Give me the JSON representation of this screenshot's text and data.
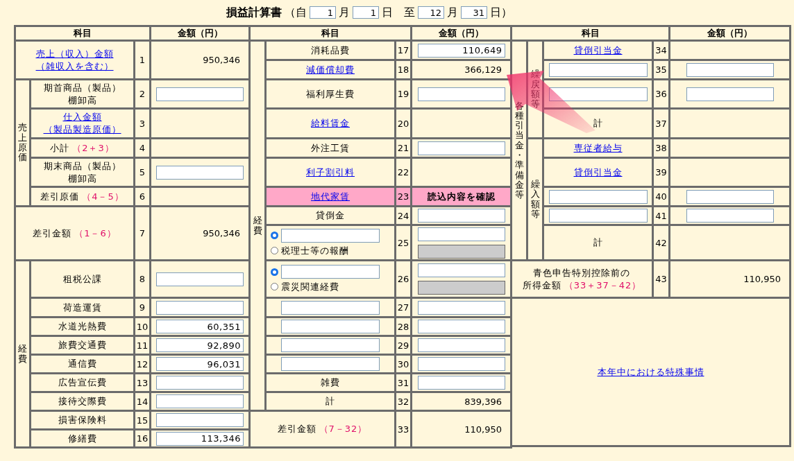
{
  "title": "損益計算書",
  "period": [
    {
      "kind": "text",
      "text": "（自"
    },
    {
      "kind": "field",
      "value": "1"
    },
    {
      "kind": "text",
      "text": "月"
    },
    {
      "kind": "field",
      "value": "1"
    },
    {
      "kind": "text",
      "text": "日　至"
    },
    {
      "kind": "field",
      "value": "12"
    },
    {
      "kind": "text",
      "text": "月"
    },
    {
      "kind": "field",
      "value": "31"
    },
    {
      "kind": "text",
      "text": "日）"
    }
  ],
  "left": {
    "headers": [
      "科目",
      "金額（円）"
    ],
    "sections": [
      {
        "kind": "single",
        "row": {
          "no": "1",
          "label": {
            "kind": "link",
            "lines": [
              "売上（収入）金額",
              "（雑収入を含む）"
            ]
          },
          "amount": {
            "kind": "text",
            "value": "950,346"
          }
        }
      },
      {
        "kind": "group",
        "label": "売上原価",
        "rows": [
          {
            "no": "2",
            "label": {
              "kind": "text",
              "lines": [
                "期首商品（製品）",
                "棚卸高"
              ]
            },
            "amount": {
              "kind": "field"
            }
          },
          {
            "no": "3",
            "label": {
              "kind": "link",
              "lines": [
                "仕入金額",
                "（製品製造原価）"
              ]
            },
            "amount": {
              "kind": "none"
            }
          },
          {
            "no": "4",
            "label": {
              "kind": "text",
              "lines": [
                "小計"
              ]
            },
            "formula": "（2＋3）",
            "amount": {
              "kind": "none"
            }
          },
          {
            "no": "5",
            "label": {
              "kind": "text",
              "lines": [
                "期末商品（製品）",
                "棚卸高"
              ]
            },
            "amount": {
              "kind": "field"
            }
          },
          {
            "no": "6",
            "label": {
              "kind": "text",
              "lines": [
                "差引原価"
              ]
            },
            "formula": "（4－5）",
            "amount": {
              "kind": "none"
            }
          }
        ]
      },
      {
        "kind": "single",
        "row": {
          "no": "7",
          "label": {
            "kind": "text",
            "lines": [
              "差引金額"
            ]
          },
          "formula": "（1－6）",
          "amount": {
            "kind": "text",
            "value": "950,346"
          }
        }
      },
      {
        "kind": "group",
        "label": "経費",
        "rows": [
          {
            "no": "8",
            "label": {
              "kind": "text",
              "lines": [
                "租税公課"
              ]
            },
            "amount": {
              "kind": "field"
            }
          },
          {
            "no": "9",
            "label": {
              "kind": "text",
              "lines": [
                "荷造運賃"
              ]
            },
            "amount": {
              "kind": "field"
            }
          },
          {
            "no": "10",
            "label": {
              "kind": "text",
              "lines": [
                "水道光熱費"
              ]
            },
            "amount": {
              "kind": "field",
              "value": "60,351"
            }
          },
          {
            "no": "11",
            "label": {
              "kind": "text",
              "lines": [
                "旅費交通費"
              ]
            },
            "amount": {
              "kind": "field",
              "value": "92,890"
            }
          },
          {
            "no": "12",
            "label": {
              "kind": "text",
              "lines": [
                "通信費"
              ]
            },
            "amount": {
              "kind": "field",
              "value": "96,031"
            }
          },
          {
            "no": "13",
            "label": {
              "kind": "text",
              "lines": [
                "広告宣伝費"
              ]
            },
            "amount": {
              "kind": "field"
            }
          },
          {
            "no": "14",
            "label": {
              "kind": "text",
              "lines": [
                "接待交際費"
              ]
            },
            "amount": {
              "kind": "field"
            }
          },
          {
            "no": "15",
            "label": {
              "kind": "text",
              "lines": [
                "損害保険料"
              ]
            },
            "amount": {
              "kind": "field"
            }
          },
          {
            "no": "16",
            "label": {
              "kind": "text",
              "lines": [
                "修繕費"
              ]
            },
            "amount": {
              "kind": "field",
              "value": "113,346"
            }
          }
        ]
      }
    ]
  },
  "middle": {
    "headers": [
      "科目",
      "金額（円）"
    ],
    "sections": [
      {
        "kind": "group",
        "label": "経費",
        "rows": [
          {
            "no": "17",
            "highlighted": false,
            "label": {
              "kind": "text",
              "lines": [
                "消耗品費"
              ]
            },
            "amount": {
              "kind": "field",
              "value": "110,649"
            }
          },
          {
            "no": "18",
            "highlighted": false,
            "label": {
              "kind": "link",
              "lines": [
                "減価償却費"
              ]
            },
            "amount": {
              "kind": "text",
              "value": "366,129"
            }
          },
          {
            "no": "19",
            "highlighted": false,
            "label": {
              "kind": "text",
              "lines": [
                "福利厚生費"
              ]
            },
            "amount": {
              "kind": "field"
            }
          },
          {
            "no": "20",
            "highlighted": false,
            "label": {
              "kind": "link",
              "lines": [
                "給料賃金"
              ]
            },
            "amount": {
              "kind": "none"
            }
          },
          {
            "no": "21",
            "highlighted": false,
            "label": {
              "kind": "text",
              "lines": [
                "外注工賃"
              ]
            },
            "amount": {
              "kind": "field"
            }
          },
          {
            "no": "22",
            "highlighted": false,
            "label": {
              "kind": "link",
              "lines": [
                "利子割引料"
              ]
            },
            "amount": {
              "kind": "none"
            }
          },
          {
            "no": "23",
            "highlighted": true,
            "label": {
              "kind": "link",
              "lines": [
                "地代家賃"
              ]
            },
            "amount": {
              "kind": "notice",
              "value": "読込内容を確認"
            }
          },
          {
            "no": "24",
            "highlighted": false,
            "label": {
              "kind": "text",
              "lines": [
                "貸倒金"
              ]
            },
            "amount": {
              "kind": "field"
            }
          },
          {
            "no": "25",
            "highlighted": false,
            "label": {
              "kind": "choice",
              "options": [
                {
                  "kind": "field",
                  "selected": true
                },
                {
                  "kind": "text",
                  "text": "税理士等の報酬",
                  "selected": false
                }
              ]
            },
            "amount": {
              "kind": "pair",
              "fields": [
                {
                  "disabled": false
                },
                {
                  "disabled": true
                }
              ]
            }
          },
          {
            "no": "26",
            "highlighted": false,
            "label": {
              "kind": "choice",
              "options": [
                {
                  "kind": "field",
                  "selected": true
                },
                {
                  "kind": "text",
                  "text": "震災関連経費",
                  "selected": false
                }
              ]
            },
            "amount": {
              "kind": "pair",
              "fields": [
                {
                  "disabled": false
                },
                {
                  "disabled": true
                }
              ]
            }
          },
          {
            "no": "27",
            "highlighted": false,
            "label": {
              "kind": "field"
            },
            "amount": {
              "kind": "field"
            }
          },
          {
            "no": "28",
            "highlighted": false,
            "label": {
              "kind": "field"
            },
            "amount": {
              "kind": "field"
            }
          },
          {
            "no": "29",
            "highlighted": false,
            "label": {
              "kind": "field"
            },
            "amount": {
              "kind": "field"
            }
          },
          {
            "no": "30",
            "highlighted": false,
            "label": {
              "kind": "field"
            },
            "amount": {
              "kind": "field"
            }
          },
          {
            "no": "31",
            "highlighted": false,
            "label": {
              "kind": "text",
              "lines": [
                "雑費"
              ]
            },
            "amount": {
              "kind": "field"
            }
          },
          {
            "no": "32",
            "highlighted": false,
            "label": {
              "kind": "text",
              "lines": [
                "計"
              ]
            },
            "amount": {
              "kind": "text",
              "value": "839,396"
            }
          }
        ]
      },
      {
        "kind": "single",
        "row": {
          "no": "33",
          "highlighted": false,
          "label": {
            "kind": "text",
            "lines": [
              "差引金額"
            ]
          },
          "formula": "（7－32）",
          "amount": {
            "kind": "text",
            "value": "110,950"
          }
        }
      }
    ]
  },
  "right": {
    "headers": [
      "科目",
      "金額（円）"
    ],
    "group_label": "各種引当金・準備金等",
    "subgroups": [
      {
        "label": "繰戻額等",
        "rows": [
          {
            "no": "34",
            "label": {
              "kind": "link",
              "lines": [
                "貸倒引当金"
              ]
            },
            "amount": {
              "kind": "none"
            }
          },
          {
            "no": "35",
            "label": {
              "kind": "field"
            },
            "amount": {
              "kind": "field"
            }
          },
          {
            "no": "36",
            "label": {
              "kind": "field"
            },
            "amount": {
              "kind": "field"
            }
          },
          {
            "no": "37",
            "label": {
              "kind": "text",
              "lines": [
                "計"
              ]
            },
            "amount": {
              "kind": "none"
            }
          }
        ]
      },
      {
        "label": "繰入額等",
        "rows": [
          {
            "no": "38",
            "label": {
              "kind": "link",
              "lines": [
                "専従者給与"
              ]
            },
            "amount": {
              "kind": "none"
            }
          },
          {
            "no": "39",
            "label": {
              "kind": "link",
              "lines": [
                "貸倒引当金"
              ]
            },
            "amount": {
              "kind": "none"
            }
          },
          {
            "no": "40",
            "label": {
              "kind": "field"
            },
            "amount": {
              "kind": "field"
            }
          },
          {
            "no": "41",
            "label": {
              "kind": "field"
            },
            "amount": {
              "kind": "field"
            }
          },
          {
            "no": "42",
            "label": {
              "kind": "text",
              "lines": [
                "計"
              ]
            },
            "amount": {
              "kind": "none"
            }
          }
        ]
      }
    ],
    "total": {
      "no": "43",
      "label": {
        "kind": "text",
        "lines": [
          "青色申告特別控除前の",
          "所得金額"
        ]
      },
      "formula": "（33＋37－42）",
      "amount": {
        "kind": "text",
        "value": "110,950"
      }
    },
    "note_link": "本年中における特殊事情"
  }
}
